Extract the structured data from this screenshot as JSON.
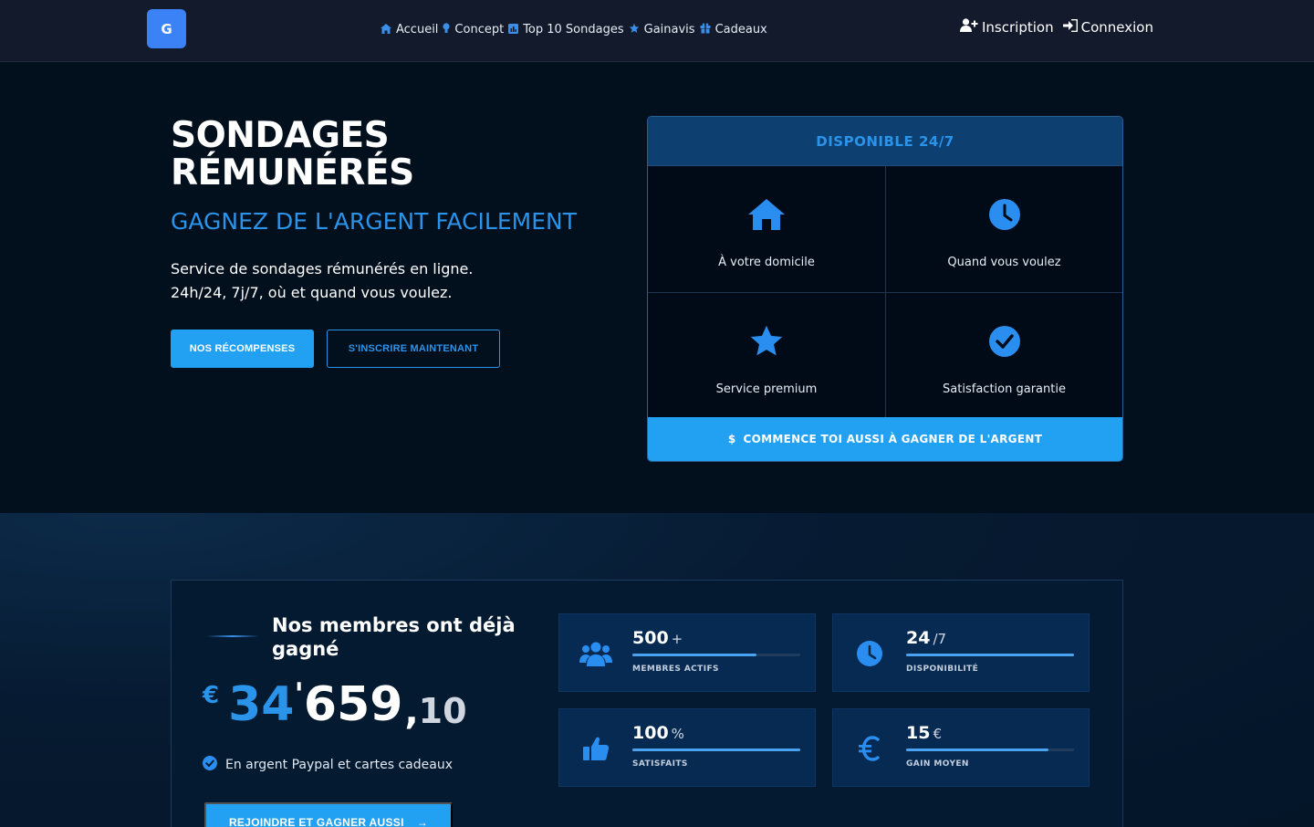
{
  "colors": {
    "accent": "#22a0f2",
    "accent_text": "#2a93ea",
    "nav_bg": "#121a2b",
    "page_bg": "#020f1d",
    "card_head": "#0d3f70",
    "stat_bg": "#072a52"
  },
  "nav": {
    "logo_letter": "G",
    "links": [
      {
        "label": "Accueil",
        "icon": "home-icon"
      },
      {
        "label": "Concept",
        "icon": "lightbulb-icon"
      },
      {
        "label": "Top 10 Sondages",
        "icon": "chart-icon"
      },
      {
        "label": "Gainavis",
        "icon": "star-icon"
      },
      {
        "label": "Cadeaux",
        "icon": "gift-icon"
      }
    ],
    "signup_label": "Inscription",
    "login_label": "Connexion"
  },
  "hero": {
    "title_line1": "SONDAGES",
    "title_line2": "RÉMUNÉRÉS",
    "subtitle": "GAGNEZ DE L'ARGENT FACILEMENT",
    "desc_line1": "Service de sondages rémunérés en ligne.",
    "desc_line2": "24h/24, 7j/7, où et quand vous voulez.",
    "btn_rewards": "NOS RÉCOMPENSES",
    "btn_signup": "S'INSCRIRE MAINTENANT"
  },
  "card": {
    "header": "DISPONIBLE 24/7",
    "features": [
      {
        "label": "À votre domicile",
        "icon": "home-icon"
      },
      {
        "label": "Quand vous voulez",
        "icon": "clock-icon"
      },
      {
        "label": "Service premium",
        "icon": "star-icon"
      },
      {
        "label": "Satisfaction garantie",
        "icon": "check-circle-icon"
      }
    ],
    "footer_label": "COMMENCE TOI AUSSI À GAGNER DE L'ARGENT",
    "footer_icon": "dollar-icon"
  },
  "stats": {
    "title": "Nos membres ont déjà gagné",
    "amount": {
      "currency": "€",
      "int_part": "34",
      "apostrophe": "'",
      "main_part": "659",
      "comma": ",",
      "decimal": "10"
    },
    "paypal_note": "En argent Paypal et cartes cadeaux",
    "join_button": "REJOINDRE ET GAGNER AUSSI",
    "join_arrow": "→",
    "items": [
      {
        "value": "500",
        "suffix": "+",
        "label": "MEMBRES ACTIFS",
        "icon": "users-icon",
        "progress": 0.74
      },
      {
        "value": "24",
        "suffix": "/7",
        "label": "DISPONIBILITÉ",
        "icon": "clock-icon",
        "progress": 1.0
      },
      {
        "value": "100",
        "suffix": "%",
        "label": "SATISFAITS",
        "icon": "thumbs-up-icon",
        "progress": 1.0
      },
      {
        "value": "15",
        "suffix": "€",
        "label": "GAIN MOYEN",
        "icon": "euro-icon",
        "progress": 0.85
      }
    ]
  }
}
